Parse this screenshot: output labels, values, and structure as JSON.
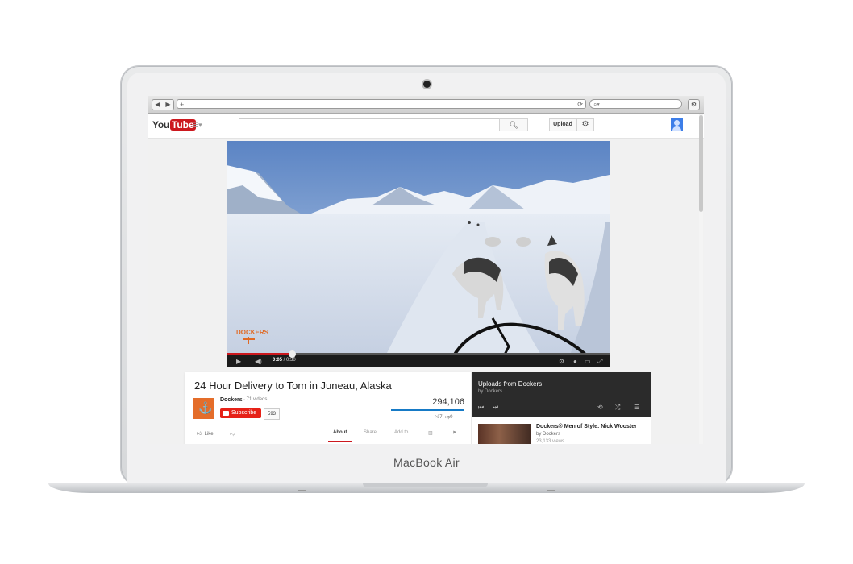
{
  "device": {
    "brand": "MacBook Air"
  },
  "browser": {
    "nav_back": "◀",
    "nav_forward": "▶",
    "new_tab": "+",
    "reload_icon": "reload-icon",
    "search_icon": "search-icon",
    "menu_icon": "gear-icon"
  },
  "youtube": {
    "logo_you": "You",
    "logo_tube": "Tube",
    "upload_label": "Upload",
    "accent": "#cc181e"
  },
  "player": {
    "current_time": "0:05",
    "duration": "0:30",
    "time_separator": " / ",
    "progress": 0.17,
    "watermark": "DOCKERS"
  },
  "video_info": {
    "title": "24 Hour Delivery to Tom in Juneau, Alaska",
    "channel_name": "Dockers",
    "channel_videos": "· 71 videos",
    "subscribe_label": "Subscribe",
    "subscriber_count": "593",
    "view_count": "294,106",
    "like_count": "7",
    "dislike_count": "0",
    "like_label": "Like",
    "tabs": [
      "About",
      "Share",
      "Add to"
    ],
    "active_tab": "About"
  },
  "playlist": {
    "title": "Uploads from Dockers",
    "by": "by Dockers",
    "items": [
      {
        "title": "Dockers® Men of Style: Nick Wooster",
        "by": "by Dockers",
        "views": "23,133 views"
      }
    ]
  }
}
